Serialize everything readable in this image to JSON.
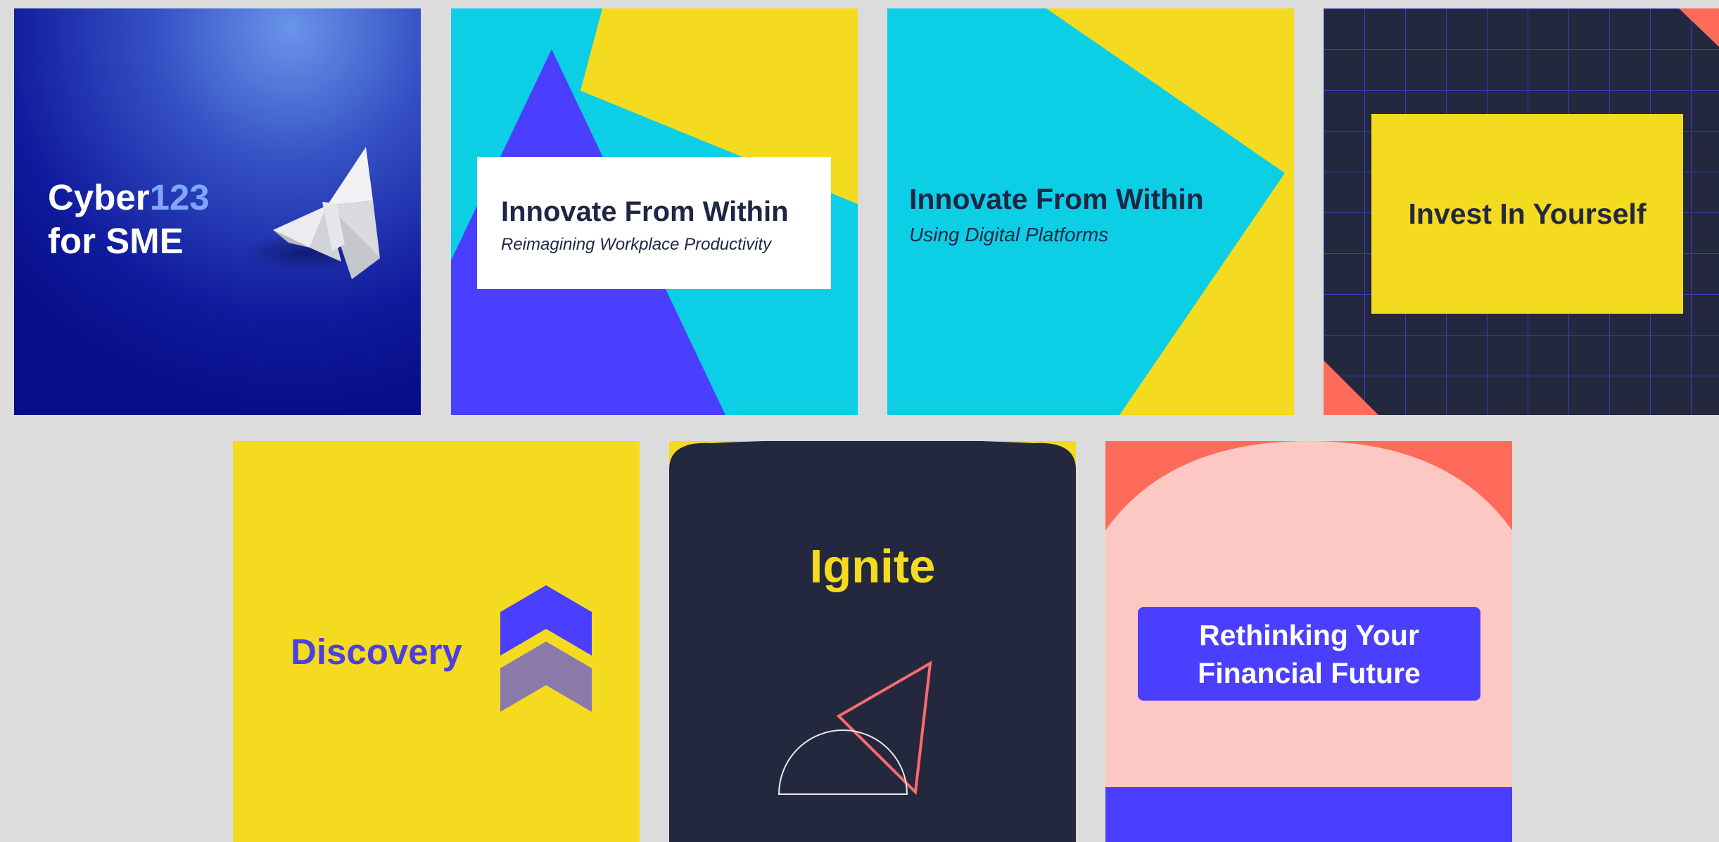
{
  "tiles": [
    {
      "title_line1_prefix": "Cyber",
      "title_line1_accent": "123",
      "title_line2": "for SME",
      "image": "origami-butterfly"
    },
    {
      "heading": "Innovate From Within",
      "subheading": "Reimagining Workplace Productivity"
    },
    {
      "heading": "Innovate From Within",
      "subheading": "Using Digital Platforms"
    },
    {
      "heading": "Invest In Yourself"
    },
    {
      "heading": "Discovery",
      "icon": "double-chevron-up-icon"
    },
    {
      "heading": "Ignite",
      "icon": "triangle-and-semicircle-outline-icon"
    },
    {
      "heading_line1": "Rethinking Your",
      "heading_line2": "Financial Future"
    }
  ],
  "colors": {
    "navy": "#1e2645",
    "cyan": "#0ccfe6",
    "yellow": "#f4db1f",
    "violet": "#4a3fff",
    "coral": "#ff6b5b",
    "pink": "#fdc8c4",
    "deep_blue": "#0a0f8c"
  }
}
